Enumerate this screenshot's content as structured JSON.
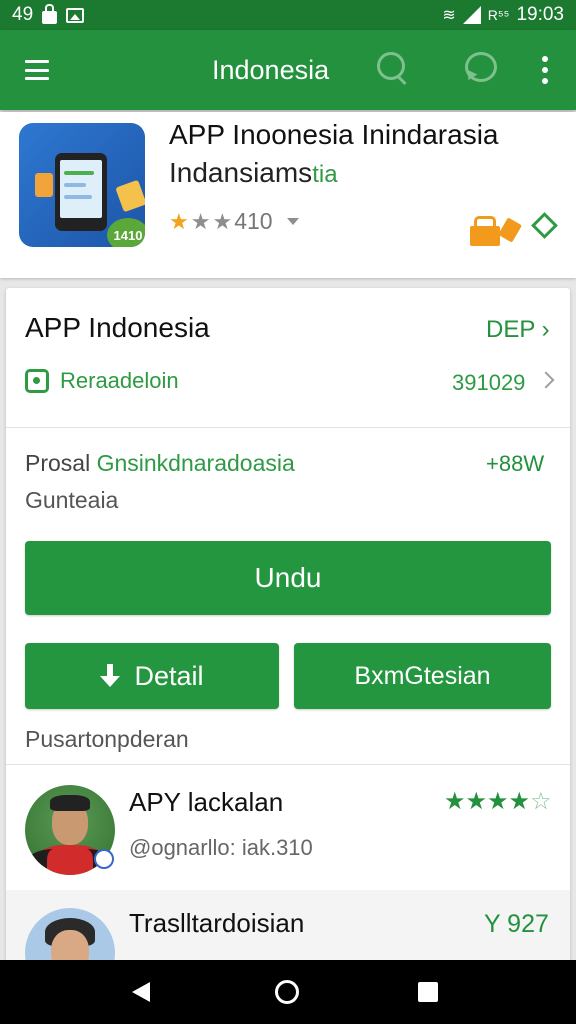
{
  "status_bar": {
    "left_text": "49",
    "network_label": "R⁵⁵",
    "time": "19:03"
  },
  "toolbar": {
    "title": "Indonesia"
  },
  "app_header": {
    "title": "APP Inoonesia Inindarasia",
    "subtitle_main": "Indansiams",
    "subtitle_green": "tia",
    "rating_text": "410",
    "rating_stars": 2,
    "icon_badge": "1410"
  },
  "main_card": {
    "title": "APP Indonesia",
    "title_action": "DEP",
    "row2_label": "Reraadeloin",
    "row2_value": "391029",
    "desc_prefix": "Prosal ",
    "desc_green": "Gnsinkdnaradoasia",
    "desc_value": "+88W",
    "desc_line2": "Gunteaia",
    "primary_button": "Undu",
    "detail_button": "Detail",
    "secondary_button": "BxmGtesian",
    "footer_label": "Pusartonpderan"
  },
  "reviews": [
    {
      "name": "APY lackalan",
      "handle": "@ognarllo: iak.310",
      "stars": 4,
      "stars_max": 5
    },
    {
      "name": "Traslltardoisian",
      "value": "Y 927"
    }
  ],
  "colors": {
    "status_bar": "#1b7a30",
    "toolbar": "#23913d",
    "accent_green": "#23963f",
    "star_gold": "#f2a31a"
  },
  "icons": {
    "menu": "hamburger-icon",
    "search": "search-icon",
    "chat": "chat-icon",
    "more": "more-vert-icon",
    "gift": "gift-icon",
    "diamond": "diamond-icon",
    "download": "download-icon"
  }
}
